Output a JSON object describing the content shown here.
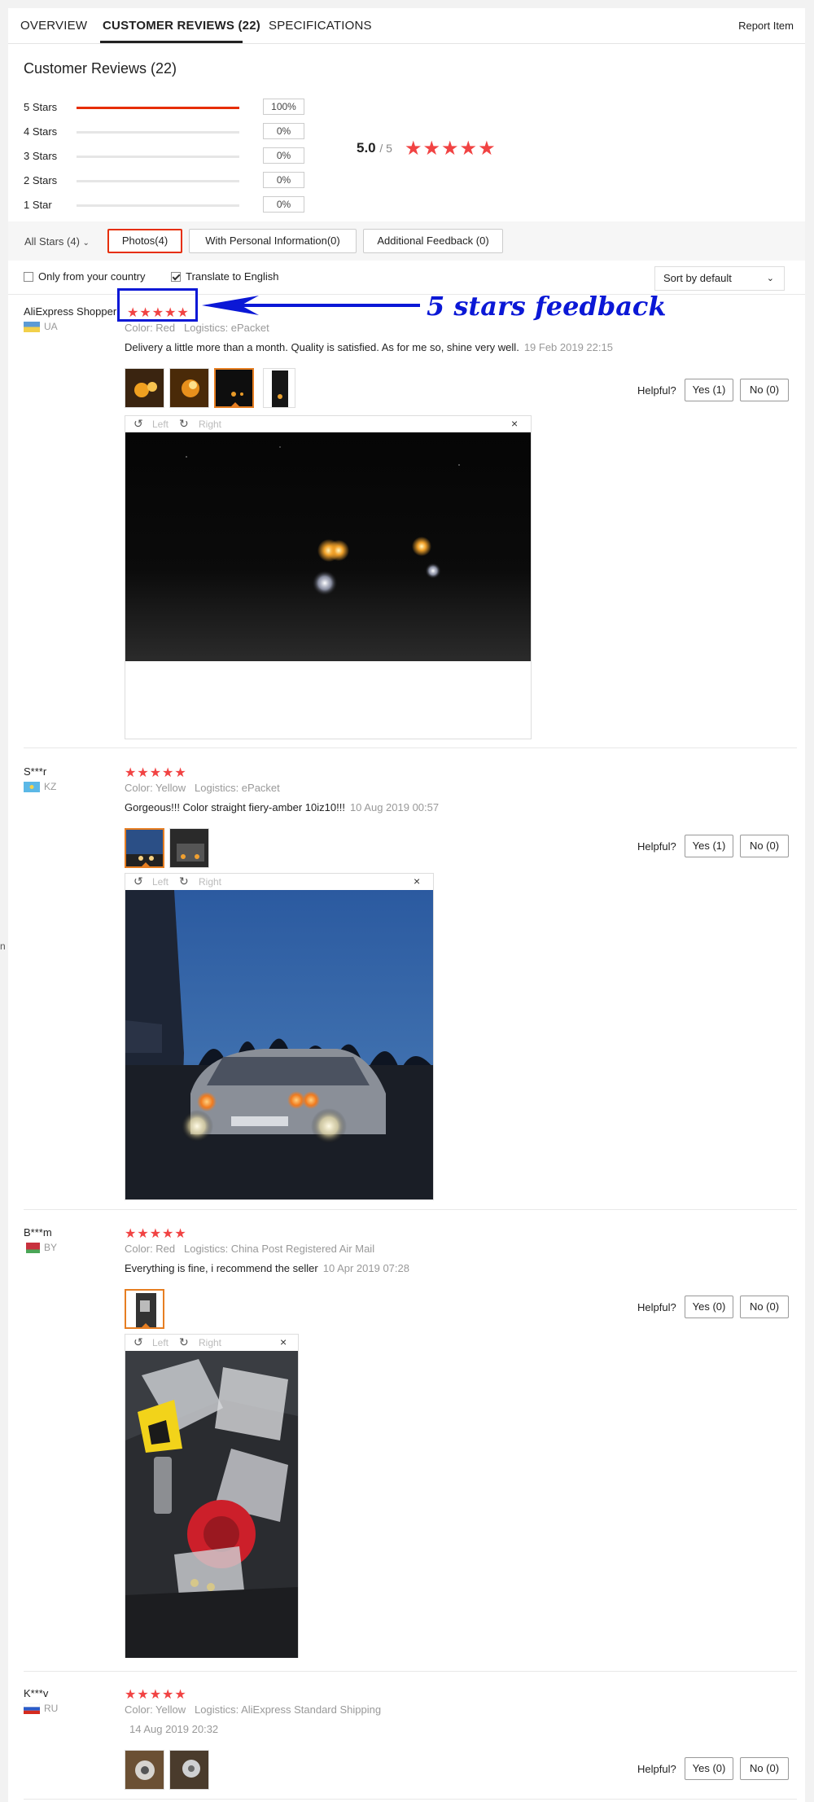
{
  "tabs": [
    {
      "label": "OVERVIEW"
    },
    {
      "label": "CUSTOMER REVIEWS (22)"
    },
    {
      "label": "SPECIFICATIONS"
    }
  ],
  "report_label": "Report Item",
  "reviews_title": "Customer Reviews (22)",
  "distribution": [
    {
      "label": "5 Stars",
      "pct": "100%",
      "fill": 1.0
    },
    {
      "label": "4 Stars",
      "pct": "0%",
      "fill": 0
    },
    {
      "label": "3 Stars",
      "pct": "0%",
      "fill": 0
    },
    {
      "label": "2 Stars",
      "pct": "0%",
      "fill": 0
    },
    {
      "label": "1 Star",
      "pct": "0%",
      "fill": 0
    }
  ],
  "average": {
    "score": "5.0",
    "out_of": "/ 5",
    "stars": "★★★★★"
  },
  "filters": {
    "all_stars": "All Stars (4)",
    "photos": "Photos(4)",
    "personal": "With Personal Information(0)",
    "additional": "Additional Feedback (0)"
  },
  "options": {
    "only_country": "Only from your country",
    "translate": "Translate to English",
    "sort": "Sort by default"
  },
  "viewer_labels": {
    "left": "Left",
    "right": "Right",
    "close": "×"
  },
  "helpful_label": "Helpful?",
  "annotation": "5 stars feedback",
  "reviews": [
    {
      "name": "AliExpress Shopper",
      "country": "UA",
      "stars": "★★★★★",
      "color": "Color: Red",
      "logistics": "Logistics: ePacket",
      "text": "Delivery a little more than a month. Quality is satisfied. As for me so, shine very well.",
      "date": "19 Feb 2019 22:15",
      "yes": "Yes (1)",
      "no": "No (0)"
    },
    {
      "name": "S***r",
      "country": "KZ",
      "stars": "★★★★★",
      "color": "Color: Yellow",
      "logistics": "Logistics: ePacket",
      "text": "Gorgeous!!! Color straight fiery-amber 10iz10!!!",
      "date": "10 Aug 2019 00:57",
      "yes": "Yes (1)",
      "no": "No (0)"
    },
    {
      "name": "B***m",
      "country": "BY",
      "stars": "★★★★★",
      "color": "Color: Red",
      "logistics": "Logistics: China Post Registered Air Mail",
      "text": "Everything is fine, i recommend the seller",
      "date": "10 Apr 2019 07:28",
      "yes": "Yes (0)",
      "no": "No (0)"
    },
    {
      "name": "K***v",
      "country": "RU",
      "stars": "★★★★★",
      "color": "Color: Yellow",
      "logistics": "Logistics: AliExpress Standard Shipping",
      "text": "",
      "date": "14 Aug 2019 20:32",
      "yes": "Yes (0)",
      "no": "No (0)"
    }
  ],
  "edge_text": "n"
}
